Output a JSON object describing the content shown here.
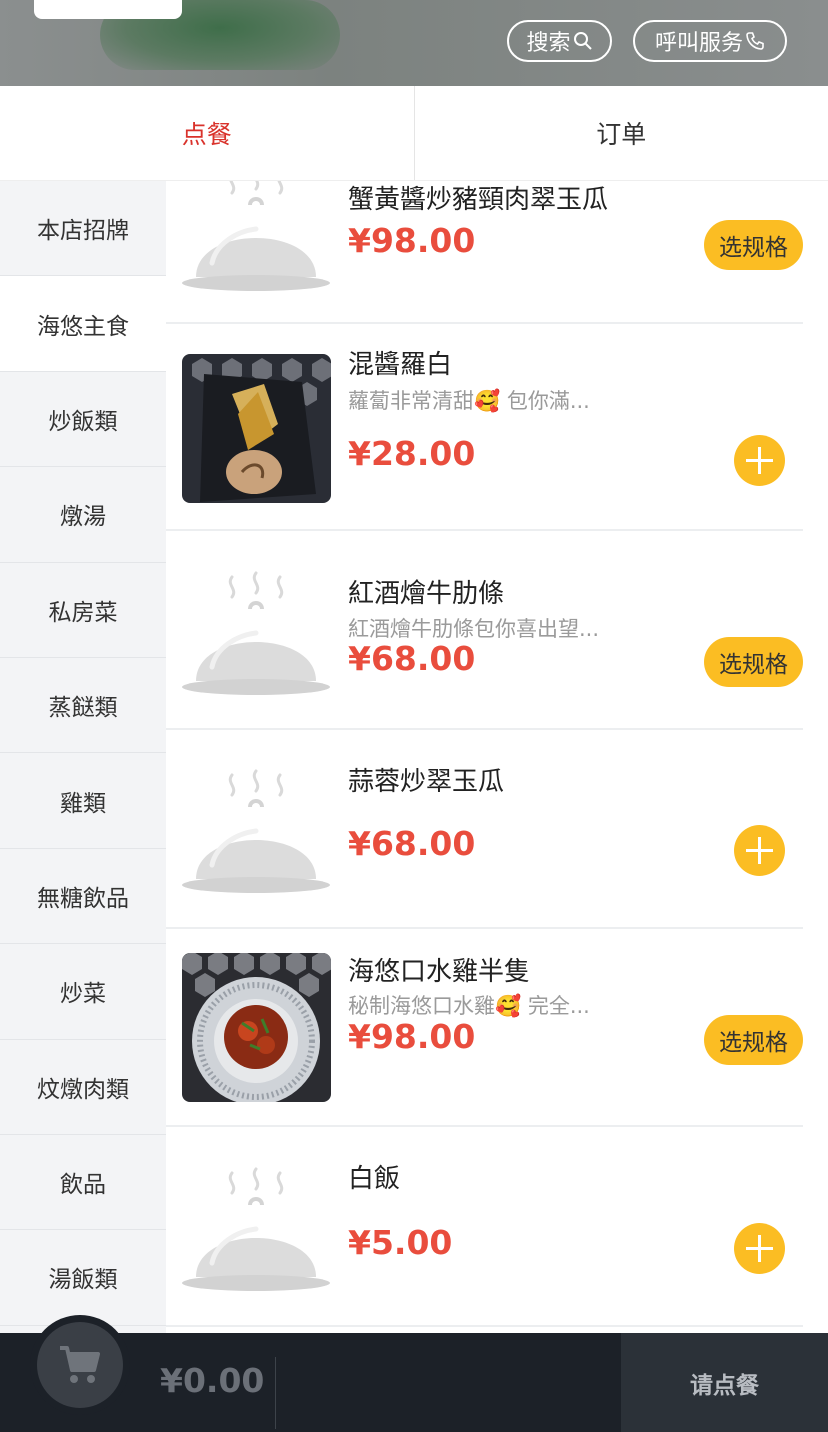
{
  "header": {
    "search_label": "搜索",
    "call_label": "呼叫服务"
  },
  "tabs": [
    {
      "label": "点餐",
      "active": true
    },
    {
      "label": "订单",
      "active": false
    }
  ],
  "sidebar": {
    "items": [
      {
        "label": "本店招牌"
      },
      {
        "label": "海悠主食",
        "active": true
      },
      {
        "label": "炒飯類"
      },
      {
        "label": "燉湯"
      },
      {
        "label": "私房菜"
      },
      {
        "label": "蒸餸類"
      },
      {
        "label": "雞類"
      },
      {
        "label": "無糖飲品"
      },
      {
        "label": "炒菜"
      },
      {
        "label": "炆燉肉類"
      },
      {
        "label": "飲品"
      },
      {
        "label": "湯飯類"
      }
    ]
  },
  "products": [
    {
      "name": "蟹黃醬炒豬頸肉翠玉瓜",
      "desc": "",
      "price": "¥98.00",
      "action": "选规格",
      "image": "placeholder-cloche"
    },
    {
      "name": "混醬羅白",
      "desc": "蘿蔔非常清甜🥰 包你滿...",
      "price": "¥28.00",
      "action": "+",
      "image": "fried-radish-photo"
    },
    {
      "name": "紅酒燴牛肋條",
      "desc": "紅酒燴牛肋條包你喜出望...",
      "price": "¥68.00",
      "action": "选规格",
      "image": "placeholder-cloche"
    },
    {
      "name": "蒜蓉炒翠玉瓜",
      "desc": "",
      "price": "¥68.00",
      "action": "+",
      "image": "placeholder-cloche"
    },
    {
      "name": "海悠口水雞半隻",
      "desc": "秘制海悠口水雞🥰 完全...",
      "price": "¥98.00",
      "action": "选规格",
      "image": "chicken-dish-photo"
    },
    {
      "name": "白飯",
      "desc": "",
      "price": "¥5.00",
      "action": "+",
      "image": "placeholder-cloche"
    }
  ],
  "cart": {
    "total": "¥0.00",
    "order_button": "请点餐"
  },
  "colors": {
    "accent_red": "#d9322b",
    "price_red": "#e94d3d",
    "button_yellow": "#fbbd23",
    "bottom_bar": "#1c2128"
  }
}
